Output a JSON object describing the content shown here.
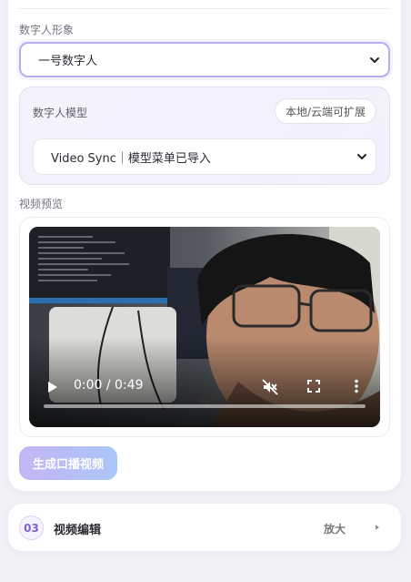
{
  "avatar_section": {
    "label": "数字人形象",
    "selected": "一号数字人"
  },
  "model_section": {
    "label": "数字人模型",
    "badge": "本地/云端可扩展",
    "selected": "Video Sync｜模型菜单已导入"
  },
  "preview_section": {
    "label": "视频预览",
    "video": {
      "time_display": "0:00 / 0:49",
      "progress_fraction": 0.0
    }
  },
  "generate_button": {
    "label": "生成口播视频"
  },
  "edit_card": {
    "step": "03",
    "title": "视频编辑",
    "zoom_label": "放大"
  },
  "colors": {
    "accent": "#7b5fe0",
    "accent_border": "#b9acf0",
    "background": "#f1f1f6"
  }
}
